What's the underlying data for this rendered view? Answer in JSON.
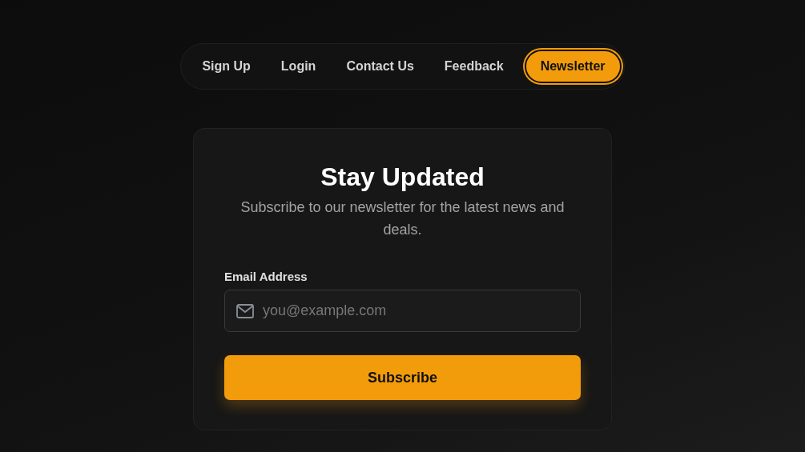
{
  "nav": {
    "items": [
      {
        "label": "Sign Up",
        "selected": false
      },
      {
        "label": "Login",
        "selected": false
      },
      {
        "label": "Contact Us",
        "selected": false
      },
      {
        "label": "Feedback",
        "selected": false
      },
      {
        "label": "Newsletter",
        "selected": true
      }
    ]
  },
  "card": {
    "title": "Stay Updated",
    "subtitle": "Subscribe to our newsletter for the latest news and deals.",
    "email": {
      "label": "Email Address",
      "placeholder": "you@example.com"
    },
    "button": "Subscribe"
  }
}
